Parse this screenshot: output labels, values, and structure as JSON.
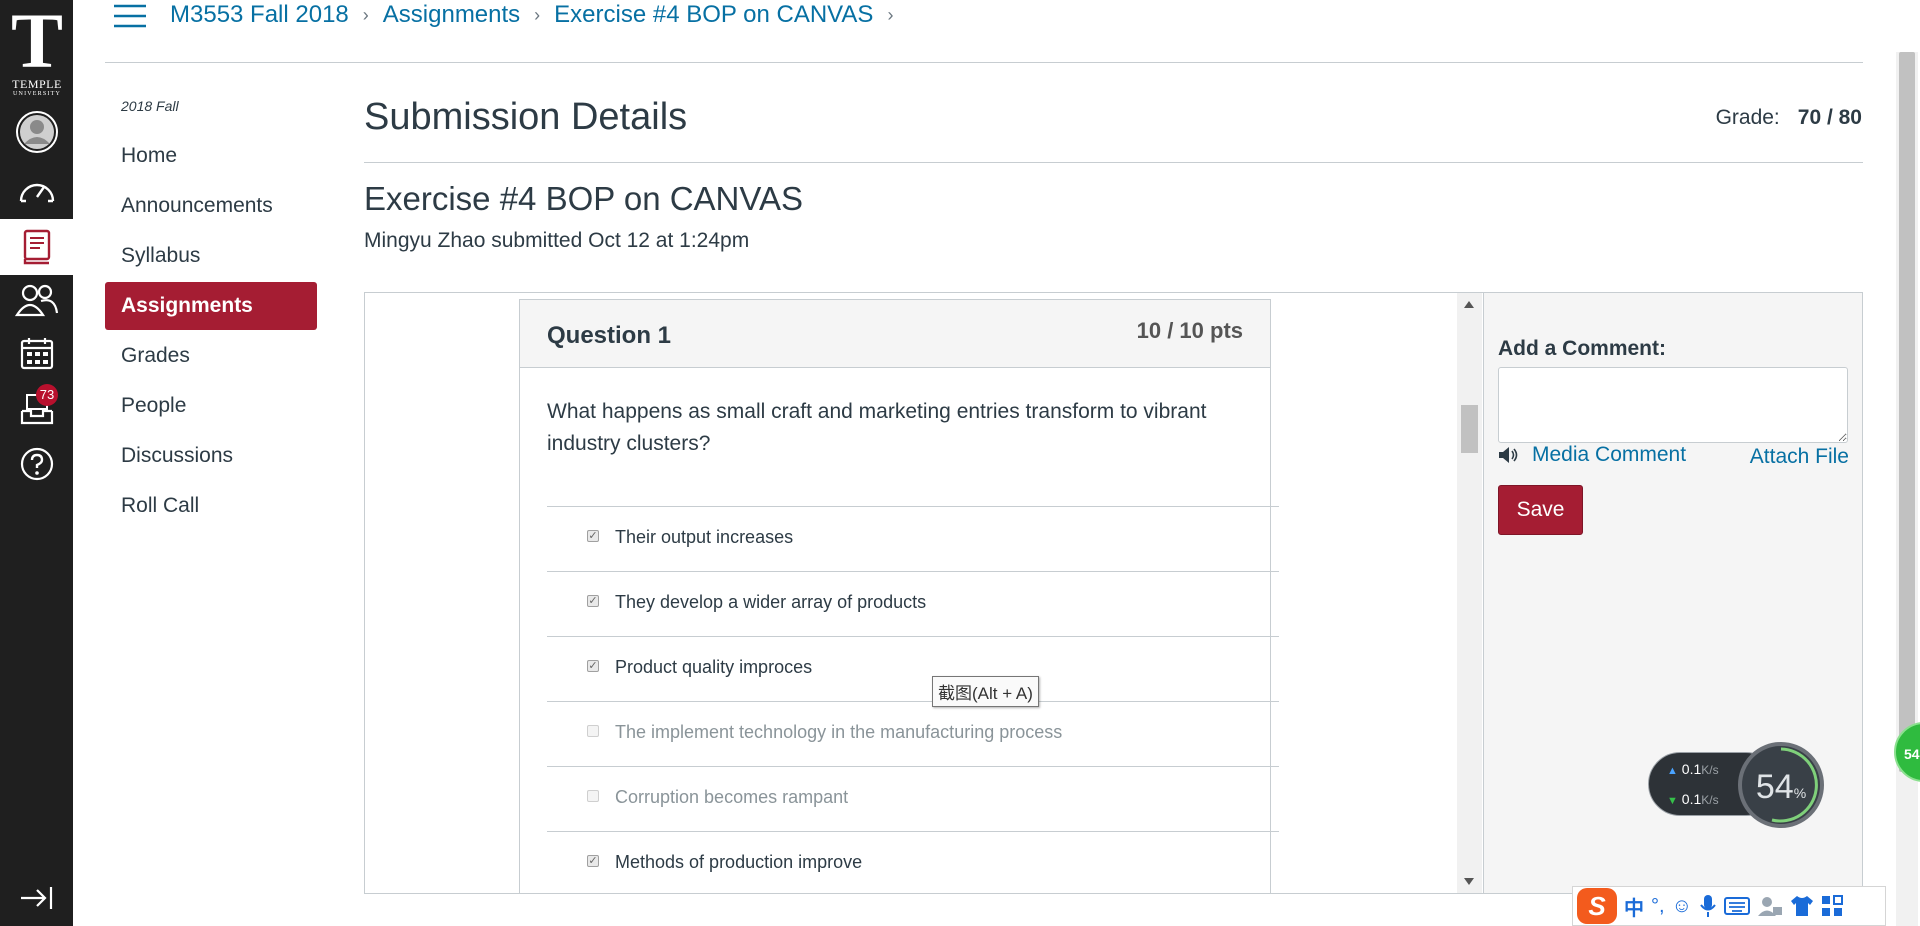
{
  "global_nav": {
    "logo_letter": "T",
    "logo_word": "TEMPLE",
    "logo_sub": "UNIVERSITY",
    "items": [
      {
        "name": "account",
        "icon": "account-icon"
      },
      {
        "name": "dashboard",
        "icon": "dashboard-icon"
      },
      {
        "name": "courses",
        "icon": "courses-icon"
      },
      {
        "name": "groups",
        "icon": "groups-icon"
      },
      {
        "name": "calendar",
        "icon": "calendar-icon"
      },
      {
        "name": "inbox",
        "icon": "inbox-icon",
        "badge": "73"
      },
      {
        "name": "help",
        "icon": "help-icon"
      }
    ],
    "accent": "#a51d33"
  },
  "breadcrumb": {
    "items": [
      "M3553 Fall 2018",
      "Assignments",
      "Exercise #4 BOP on CANVAS"
    ],
    "sep": "›"
  },
  "course_nav": {
    "term": "2018 Fall",
    "items": [
      "Home",
      "Announcements",
      "Syllabus",
      "Assignments",
      "Grades",
      "People",
      "Discussions",
      "Roll Call"
    ],
    "active_index": 3
  },
  "main": {
    "title": "Submission Details",
    "grade_label": "Grade:",
    "grade_value": "70 / 80",
    "assignment_title": "Exercise #4 BOP on CANVAS",
    "submitted_text": "Mingyu Zhao submitted Oct 12 at 1:24pm"
  },
  "question": {
    "label": "Question 1",
    "points": "10 / 10 pts",
    "text": "What happens as small craft and marketing entries transform to vibrant industry clusters?",
    "answers": [
      {
        "text": "Their output increases",
        "checked": true
      },
      {
        "text": "They develop a wider array of products",
        "checked": true
      },
      {
        "text": "Product quality improces",
        "checked": true
      },
      {
        "text": "The implement technology in the manufacturing process",
        "checked": false
      },
      {
        "text": "Corruption becomes rampant",
        "checked": false
      },
      {
        "text": "Methods of production improve",
        "checked": true
      }
    ]
  },
  "comment": {
    "label": "Add a Comment:",
    "media_comment": "Media Comment",
    "attach_file": "Attach File",
    "save": "Save"
  },
  "tooltip": "截图(Alt + A)",
  "speed_widget": {
    "up": "0.1",
    "down": "0.1",
    "unit": "K/s",
    "percent": "54",
    "pct_sign": "%"
  },
  "side_ball": "54",
  "ime_toolbar": {
    "logo": "S",
    "mode": "中",
    "punct": "°,"
  }
}
